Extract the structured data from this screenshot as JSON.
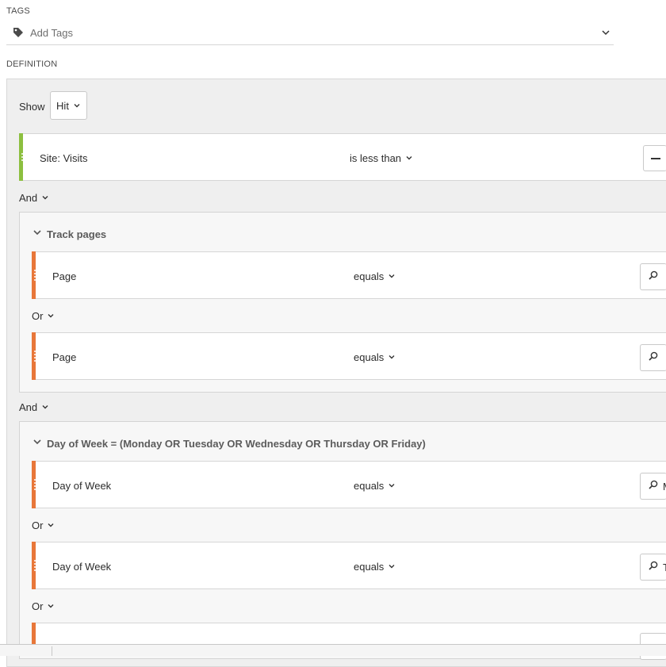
{
  "tags": {
    "section_label": "TAGS",
    "placeholder": "Add Tags",
    "icon": "tag-icon"
  },
  "definition": {
    "section_label": "DEFINITION",
    "show_label": "Show",
    "show_value": "Hit",
    "rule1": {
      "dimension": "Site: Visits",
      "operator": "is less than",
      "color": "#8cbf3f"
    },
    "and_label_1": "And",
    "container1": {
      "title": "Track pages",
      "rows": [
        {
          "dimension": "Page",
          "operator": "equals",
          "color": "#e8773a"
        },
        {
          "dimension": "Page",
          "operator": "equals",
          "color": "#e8773a"
        }
      ],
      "or_label": "Or"
    },
    "and_label_2": "And",
    "container2": {
      "title": "Day of Week = (Monday OR Tuesday OR Wednesday OR Thursday OR Friday)",
      "rows": [
        {
          "dimension": "Day of Week",
          "operator": "equals",
          "value_partial": "M",
          "color": "#e8773a"
        },
        {
          "dimension": "Day of Week",
          "operator": "equals",
          "value_partial": "T",
          "color": "#e8773a"
        }
      ],
      "or_label_1": "Or",
      "or_label_2": "Or"
    }
  },
  "colors": {
    "accent_green": "#8cbf3f",
    "accent_orange": "#e8773a",
    "panel_bg": "#efefef"
  }
}
